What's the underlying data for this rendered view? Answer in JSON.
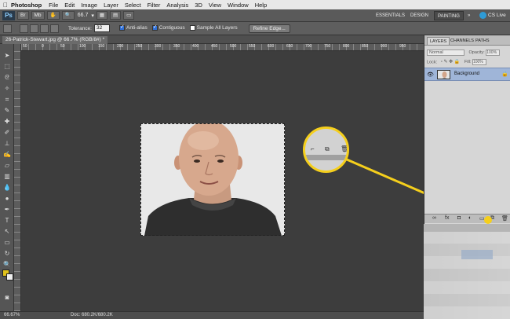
{
  "menubar": {
    "app_name": "Photoshop",
    "items": [
      "File",
      "Edit",
      "Image",
      "Layer",
      "Select",
      "Filter",
      "Analysis",
      "3D",
      "View",
      "Window",
      "Help"
    ]
  },
  "appbar": {
    "logo": "Ps",
    "zoom": "66.7",
    "workspaces": [
      "ESSENTIALS",
      "DESIGN",
      "PAINTING"
    ],
    "active_workspace": "PAINTING",
    "more": "»",
    "cs_live": "CS Live"
  },
  "options": {
    "tolerance_label": "Tolerance:",
    "tolerance_value": "32",
    "anti_alias": "Anti-alias",
    "contiguous": "Contiguous",
    "sample_all": "Sample All Layers",
    "refine_edge": "Refine Edge..."
  },
  "document": {
    "tab_title": "26-Patrick-Stewart.jpg @ 66.7% (RGB/8#) *"
  },
  "ruler": {
    "labels": [
      "50",
      "0",
      "50",
      "100",
      "150",
      "200",
      "250",
      "300",
      "350",
      "400",
      "450",
      "500",
      "550",
      "600",
      "650",
      "700",
      "750",
      "800",
      "850",
      "900",
      "950"
    ]
  },
  "status": {
    "zoom": "66.67%",
    "doc": "Doc: 680.2K/680.2K"
  },
  "layers_panel": {
    "tabs": [
      "LAYERS",
      "CHANNELS",
      "PATHS"
    ],
    "blend_mode": "Normal",
    "opacity_label": "Opacity:",
    "opacity_value": "100%",
    "lock_label": "Lock:",
    "fill_label": "Fill:",
    "fill_value": "100%",
    "layer_name": "Background"
  },
  "colors": {
    "accent_yellow": "#f5cf1c",
    "foreground_swatch": "#e0c21a",
    "selected_layer": "#9fb5d8"
  }
}
